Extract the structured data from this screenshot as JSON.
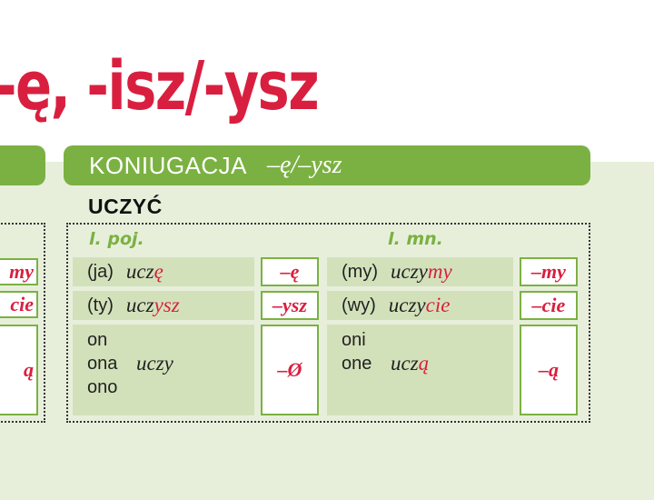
{
  "title": "-ę, -isz/-ysz",
  "header": {
    "label": "KONIUGACJA",
    "ending": "–ę/–ysz"
  },
  "verb": "UCZYĆ",
  "columns": {
    "singular": "l. poj.",
    "plural": "l. mn."
  },
  "left_fragment": {
    "boxes": [
      "my",
      "cie",
      "ą"
    ]
  },
  "singular": [
    {
      "pronoun": "(ja)",
      "stem": "ucz",
      "ending": "ę",
      "box": "–ę"
    },
    {
      "pronoun": "(ty)",
      "stem": "ucz",
      "ending": "ysz",
      "box": "–ysz"
    },
    {
      "pronouns": [
        "on",
        "ona",
        "ono"
      ],
      "stem": "uczy",
      "ending": "",
      "box": "–Ø"
    }
  ],
  "plural": [
    {
      "pronoun": "(my)",
      "stem": "uczy",
      "ending": "my",
      "box": "–my"
    },
    {
      "pronoun": "(wy)",
      "stem": "uczy",
      "ending": "cie",
      "box": "–cie"
    },
    {
      "pronouns": [
        "oni",
        "one"
      ],
      "stem": "ucz",
      "ending": "ą",
      "box": "–ą"
    }
  ],
  "colors": {
    "accent_red": "#d91f3f",
    "accent_green": "#7bb142",
    "cell_green": "#d3e1bb",
    "panel_bg": "#e7efdb"
  }
}
